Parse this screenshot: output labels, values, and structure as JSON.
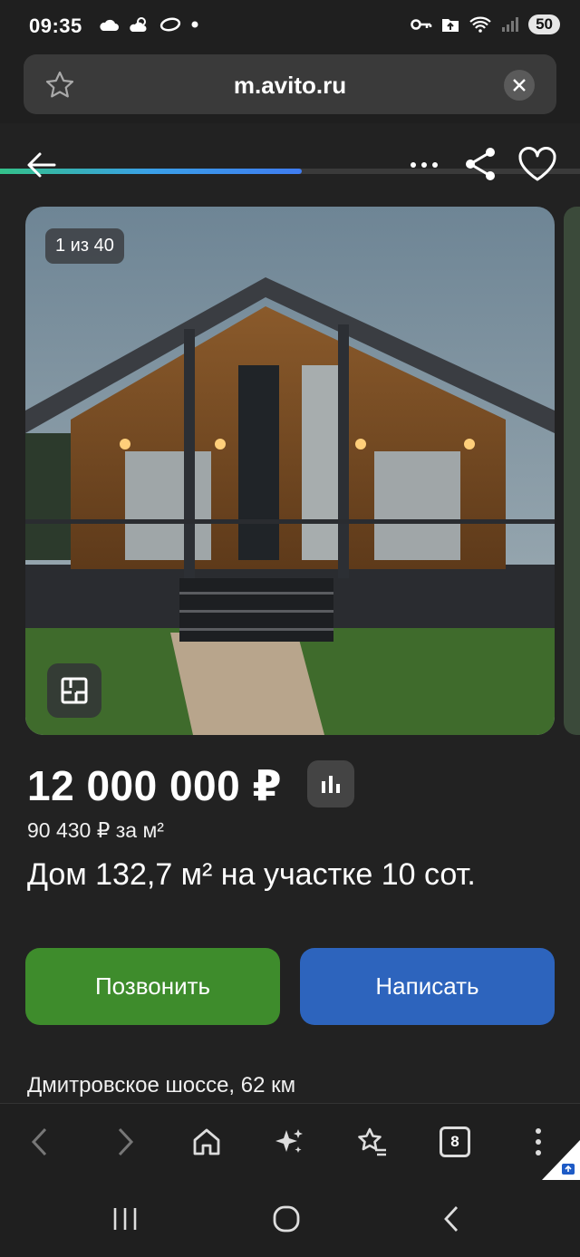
{
  "status_bar": {
    "time": "09:35",
    "battery": "50",
    "left_icons": [
      "cloud-icon",
      "weather-icon",
      "ring-icon",
      "dot-icon"
    ],
    "right_icons": [
      "key-icon",
      "upload-icon",
      "wifi-icon",
      "signal-icon",
      "battery-icon"
    ]
  },
  "browser": {
    "url": "m.avito.ru",
    "load_progress": 0.52
  },
  "listing": {
    "photo_counter": "1 из 40",
    "price": "12 000 000 ₽",
    "price_per_m2": "90 430 ₽ за м²",
    "title": "Дом 132,7 м² на участке 10 сот.",
    "call_label": "Позвонить",
    "message_label": "Написать",
    "address": "Дмитровское шоссе, 62 км"
  },
  "browser_toolbar": {
    "tabs_count": "8",
    "items": [
      "back-icon",
      "forward-icon",
      "home-icon",
      "sparkles-icon",
      "bookmarks-icon",
      "tabs-icon",
      "menu-icon"
    ]
  },
  "colors": {
    "background": "#222222",
    "call_button": "#3e8c2c",
    "message_button": "#2d64bd"
  }
}
